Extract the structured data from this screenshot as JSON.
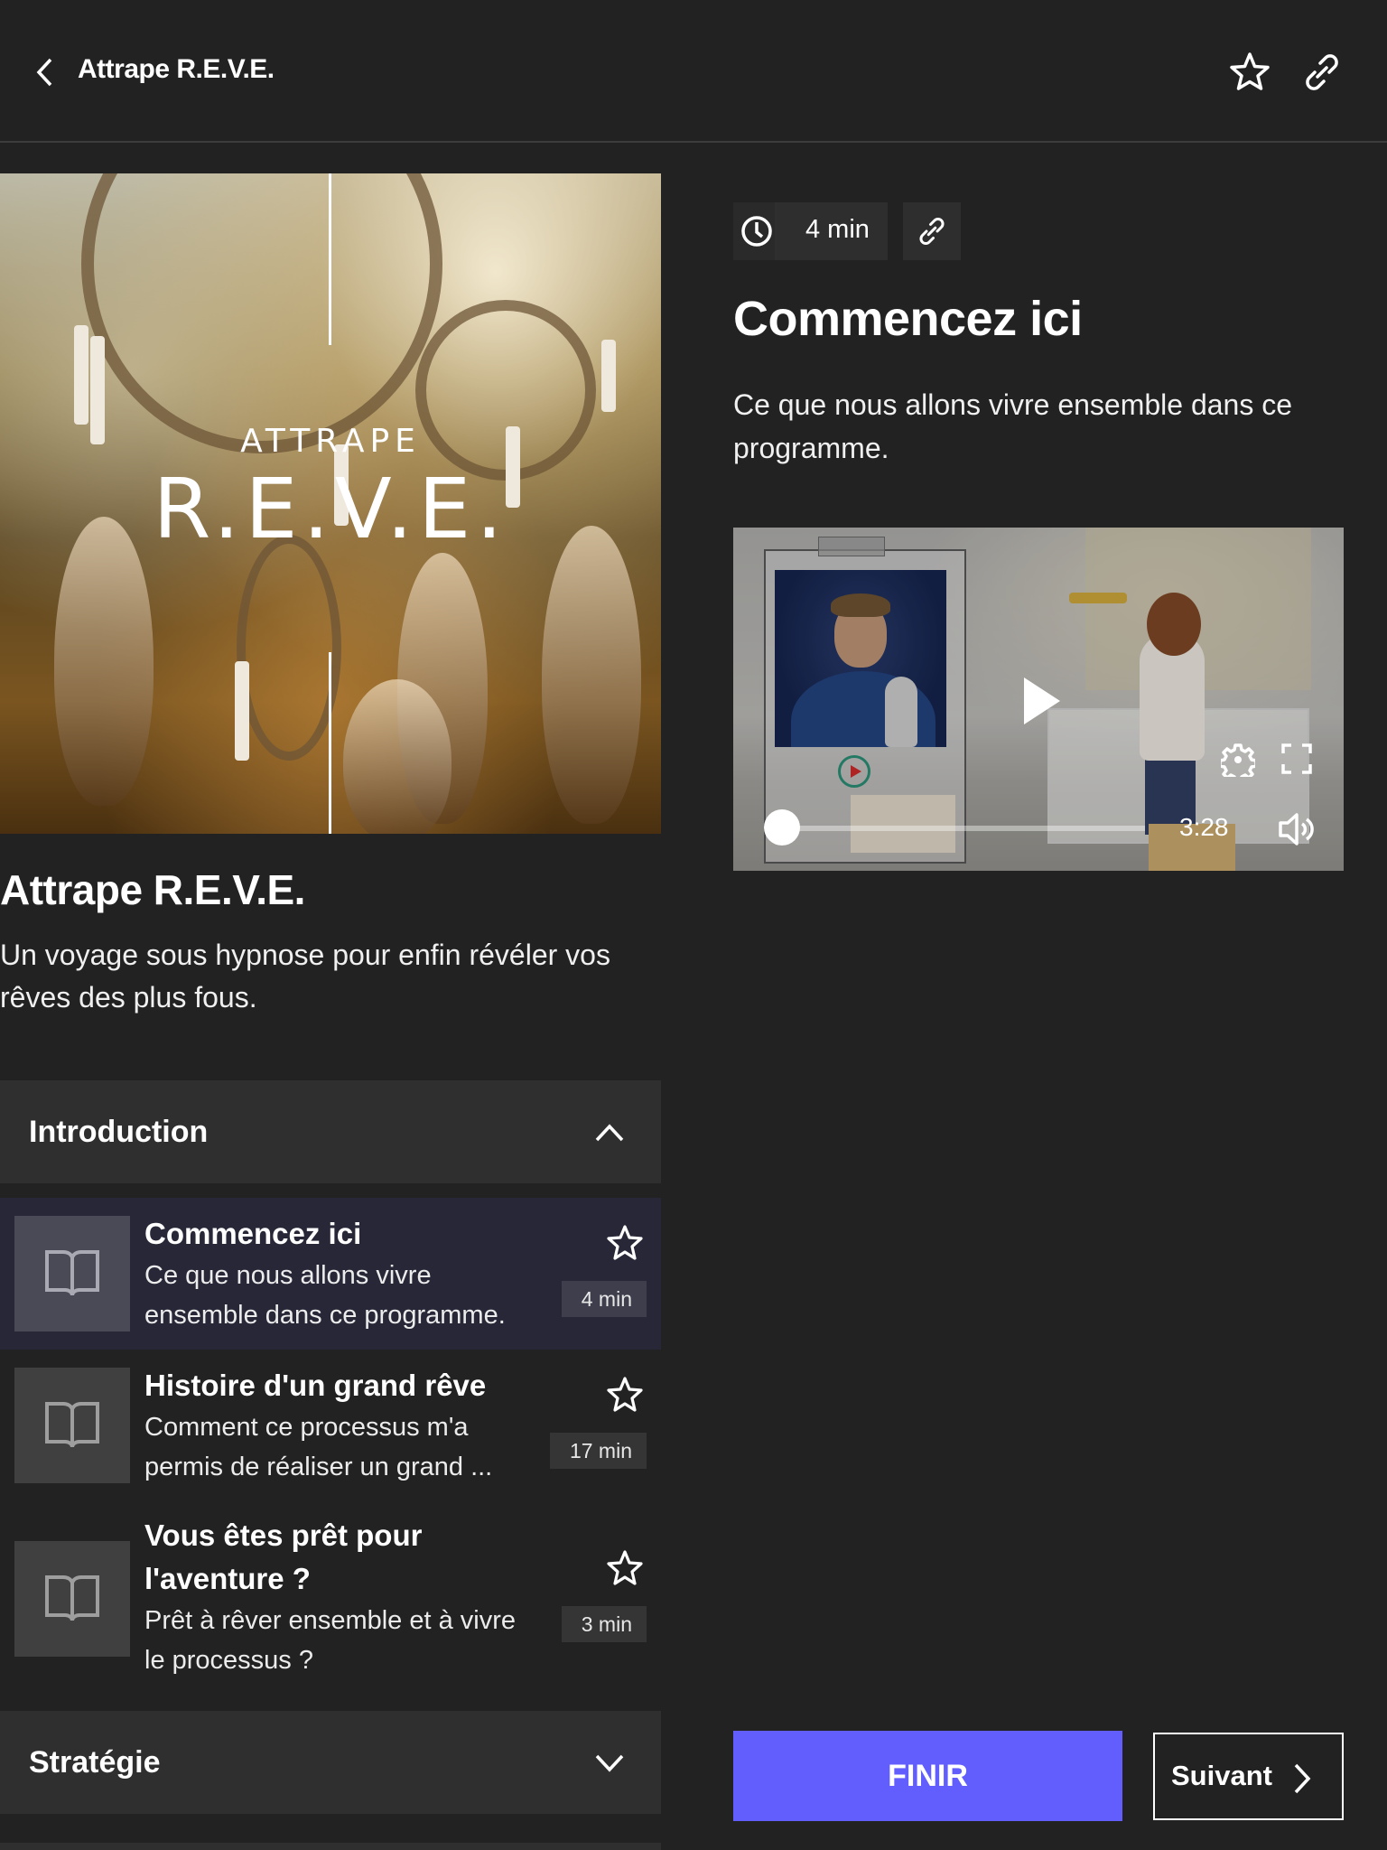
{
  "header": {
    "back_label": "Back",
    "title": "Attrape R.E.V.E.",
    "favorite_icon": "star-outline-icon",
    "share_icon": "link-icon"
  },
  "course": {
    "cover": {
      "line1": "ATTRAPE",
      "line2": "R.E.V.E."
    },
    "title": "Attrape R.E.V.E.",
    "description": "Un voyage sous hypnose pour enfin révéler vos rêves des plus fous."
  },
  "sections": [
    {
      "label": "Introduction",
      "expanded": true,
      "chevron_icon": "chevron-up-icon",
      "lessons": [
        {
          "title": "Commencez ici",
          "description": "Ce que nous allons vivre ensemble dans ce programme.",
          "duration": "4 min",
          "active": true,
          "icon": "book-open-icon"
        },
        {
          "title": "Histoire d'un grand rêve",
          "description": "Comment ce processus m'a permis de réaliser un grand ...",
          "duration": "17 min",
          "active": false,
          "icon": "book-open-icon"
        },
        {
          "title": "Vous êtes prêt pour l'aventure ?",
          "description": "Prêt à rêver ensemble et à vivre le processus ?",
          "duration": "3 min",
          "active": false,
          "icon": "book-open-icon"
        }
      ]
    },
    {
      "label": "Stratégie",
      "expanded": false,
      "chevron_icon": "chevron-down-icon",
      "lessons": []
    }
  ],
  "lesson": {
    "duration": "4 min",
    "title": "Commencez ici",
    "description": "Ce que nous allons vivre ensemble dans ce programme."
  },
  "video": {
    "duration_display": "3:28",
    "progress_fraction": 0.0,
    "play_icon": "play-icon",
    "settings_icon": "gear-icon",
    "fullscreen_icon": "fullscreen-icon",
    "volume_icon": "volume-icon"
  },
  "actions": {
    "finish_label": "FINIR",
    "next_label": "Suivant"
  },
  "colors": {
    "background": "#222222",
    "accent": "#615efd",
    "section_header": "#2f2f2f",
    "active_lesson": "#272738"
  }
}
